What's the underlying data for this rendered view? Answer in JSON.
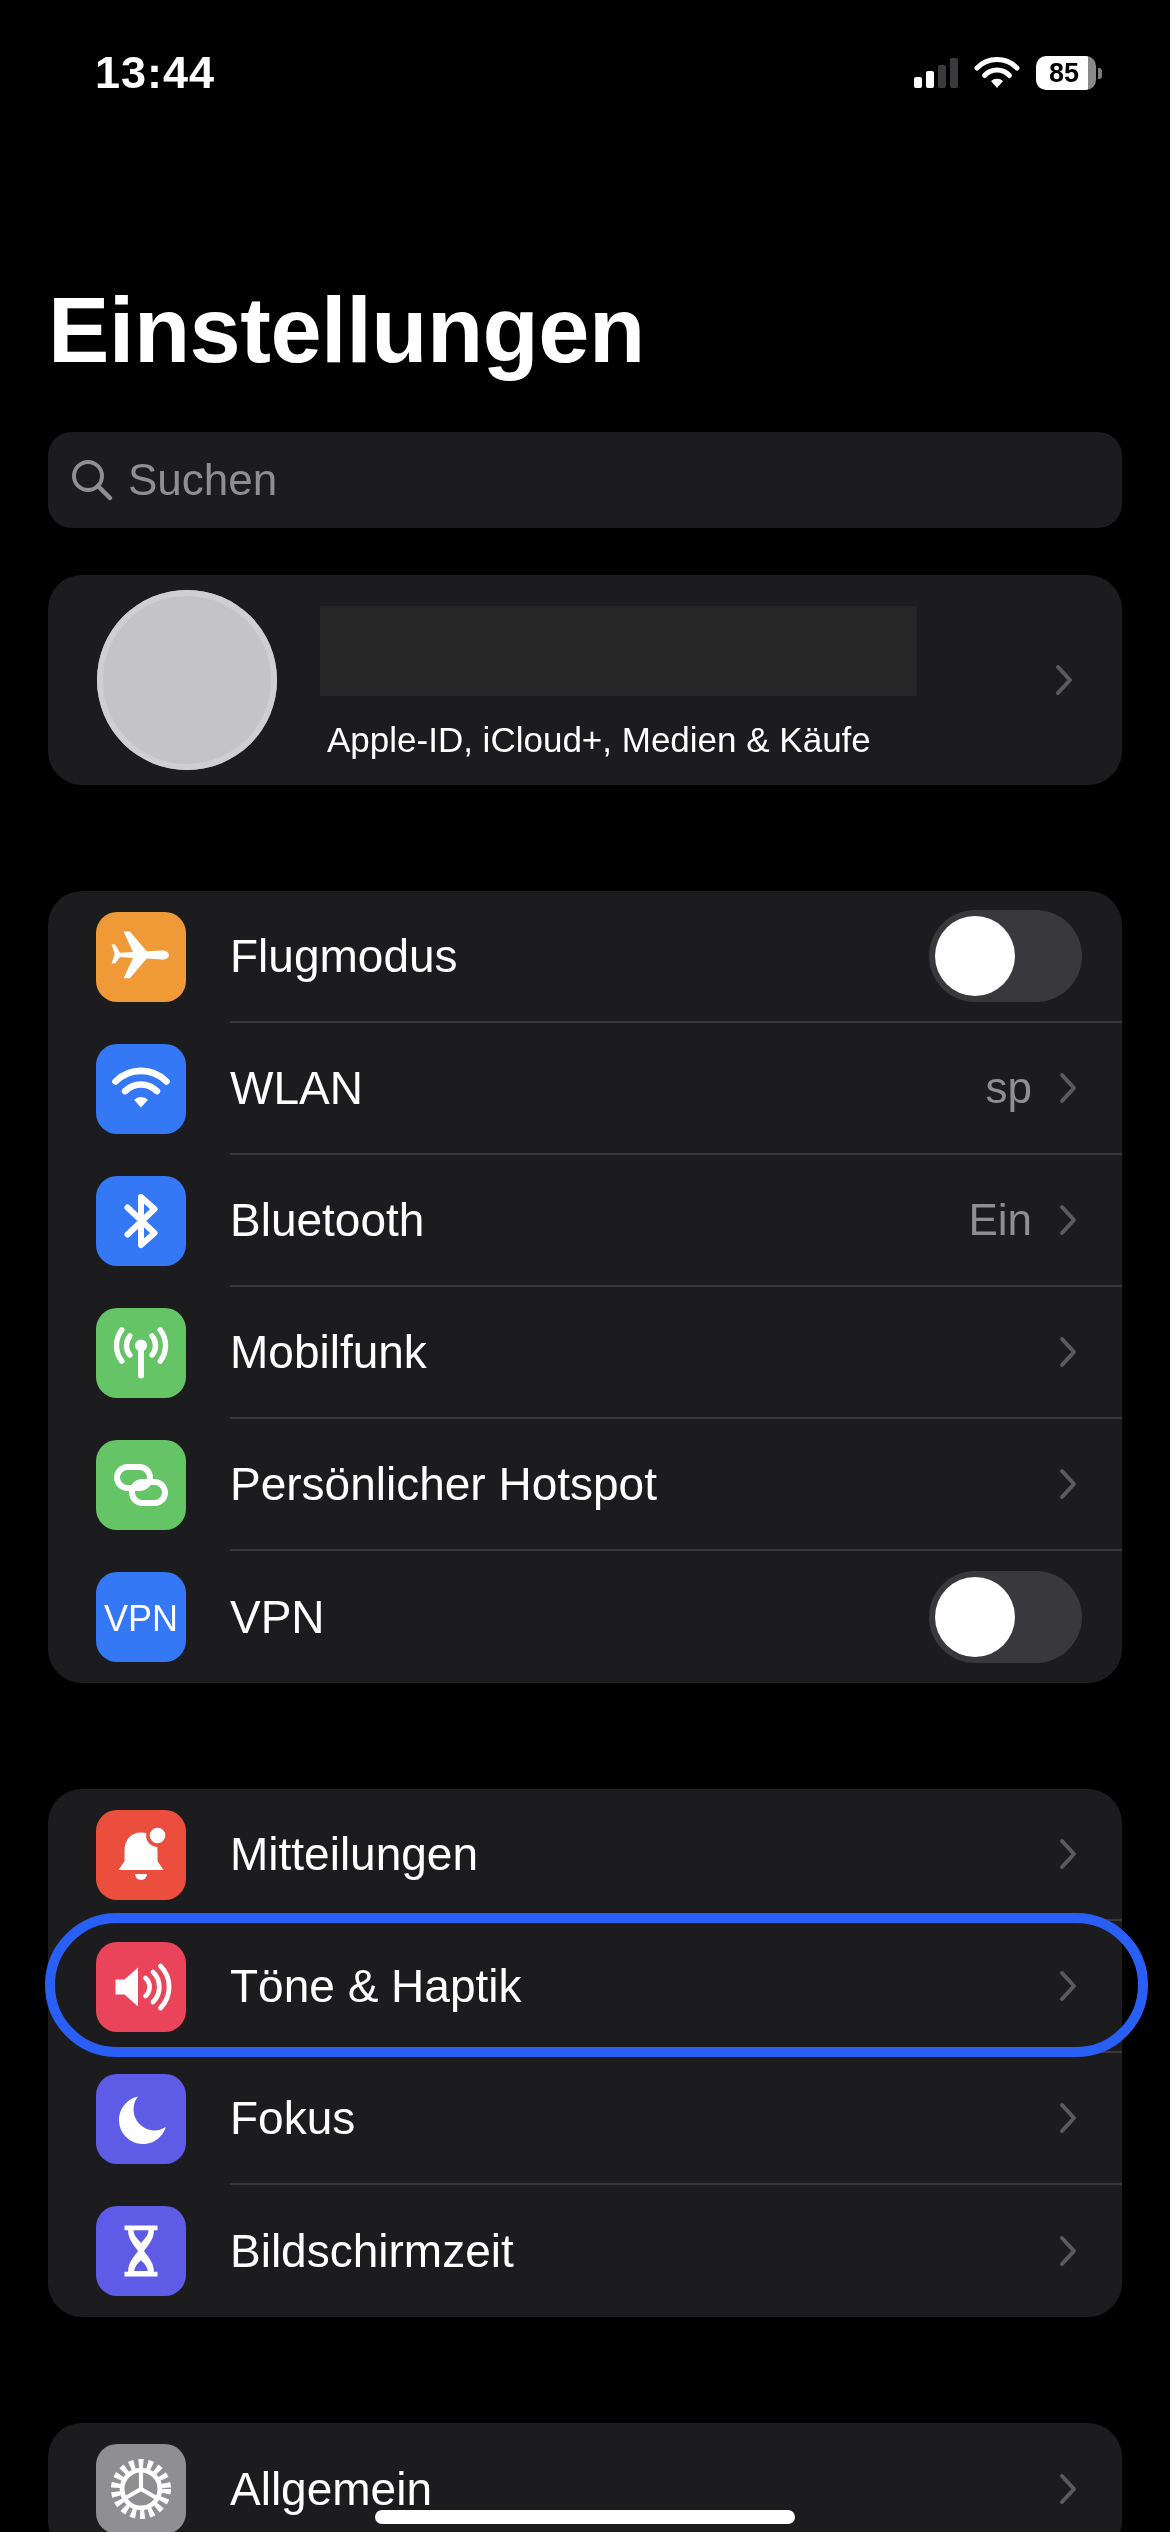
{
  "status_bar": {
    "time": "13:44",
    "battery": "85"
  },
  "title": "Einstellungen",
  "search": {
    "placeholder": "Suchen"
  },
  "profile": {
    "subtitle": "Apple-ID, iCloud+, Medien & Käufe"
  },
  "groups": [
    {
      "rows": [
        {
          "kind": "toggle",
          "label": "Flugmodus",
          "color": "#f09a37",
          "on": false,
          "highlighted": false
        },
        {
          "kind": "link",
          "label": "WLAN",
          "value": "sp",
          "color": "#3478f6",
          "highlighted": false
        },
        {
          "kind": "link",
          "label": "Bluetooth",
          "value": "Ein",
          "color": "#3478f6",
          "highlighted": false
        },
        {
          "kind": "link",
          "label": "Mobilfunk",
          "color": "#65c466",
          "highlighted": false
        },
        {
          "kind": "link",
          "label": "Persönlicher Hotspot",
          "color": "#65c466",
          "highlighted": false
        },
        {
          "kind": "toggle",
          "label": "VPN",
          "icon_label": "VPN",
          "color": "#3478f6",
          "on": false,
          "highlighted": false
        }
      ]
    },
    {
      "rows": [
        {
          "kind": "link",
          "label": "Mitteilungen",
          "color": "#eb4e3d",
          "highlighted": false
        },
        {
          "kind": "link",
          "label": "Töne & Haptik",
          "color": "#e9445a",
          "highlighted": true
        },
        {
          "kind": "link",
          "label": "Fokus",
          "color": "#5e5ce6",
          "highlighted": false
        },
        {
          "kind": "link",
          "label": "Bildschirmzeit",
          "color": "#5e5ce6",
          "highlighted": false
        }
      ]
    },
    {
      "rows": [
        {
          "kind": "link",
          "label": "Allgemein",
          "color": "#8e8e93",
          "highlighted": false
        }
      ]
    }
  ]
}
